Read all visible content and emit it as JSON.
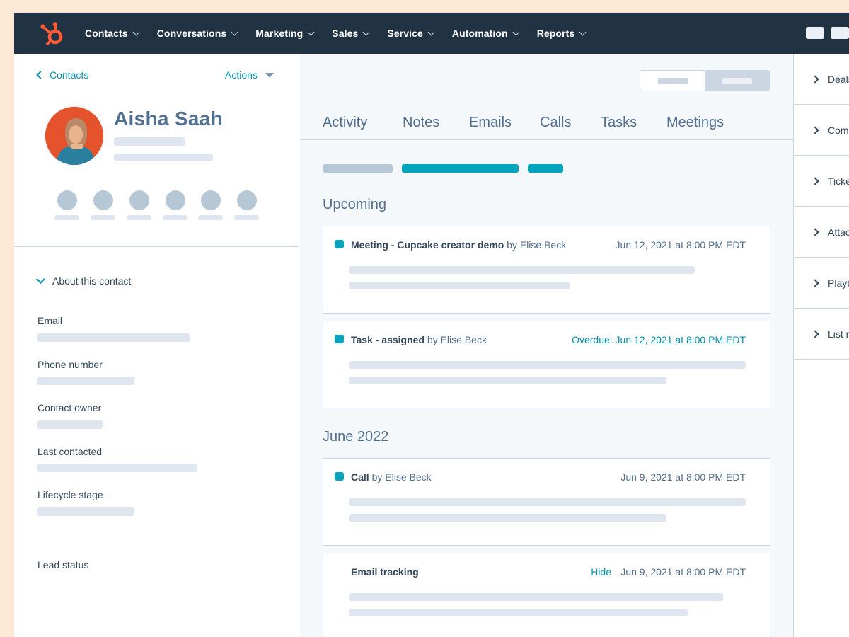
{
  "nav": {
    "items": [
      "Contacts",
      "Conversations",
      "Marketing",
      "Sales",
      "Service",
      "Automation",
      "Reports"
    ]
  },
  "left": {
    "back_label": "Contacts",
    "actions_label": "Actions",
    "contact_name": "Aisha Saah",
    "about_label": "About this contact",
    "fields": [
      "Email",
      "Phone number",
      "Contact owner",
      "Last contacted",
      "Lifecycle stage",
      "Lead status"
    ]
  },
  "center": {
    "tabs": [
      "Activity",
      "Notes",
      "Emails",
      "Calls",
      "Tasks",
      "Meetings"
    ],
    "upcoming_heading": "Upcoming",
    "month_heading": "June 2022",
    "cards": [
      {
        "title": "Meeting - Cupcake creator demo",
        "by": "by Elise Beck",
        "date": "Jun 12, 2021 at 8:00 PM EDT"
      },
      {
        "title": "Task - assigned",
        "by": "by Elise Beck",
        "date": "Overdue: Jun 12, 2021 at 8:00 PM EDT"
      },
      {
        "title": "Call",
        "by": "by Elise Beck",
        "date": "Jun 9, 2021 at 8:00 PM EDT"
      },
      {
        "title": "Email tracking",
        "by": "",
        "hide": "Hide",
        "date": "Jun 9, 2021 at 8:00 PM EDT"
      }
    ]
  },
  "right": {
    "items": [
      "Deals",
      "Companies",
      "Tickets",
      "Attachments",
      "Playbooks",
      "List memberships"
    ]
  },
  "colors": {
    "nav_bg": "#213343",
    "accent": "#00a4bd",
    "link": "#0091ae",
    "brand_orange": "#ff5c35",
    "page_bg": "#fde9d5"
  }
}
